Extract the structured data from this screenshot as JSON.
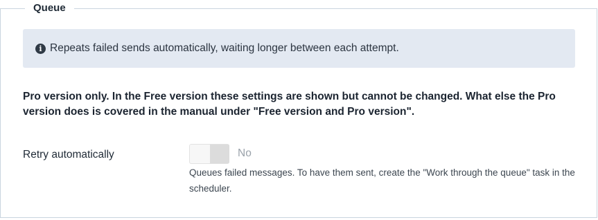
{
  "section": {
    "legend": "Queue"
  },
  "info": {
    "icon": "info-circle-icon",
    "text": "Repeats failed sends automatically, waiting longer between each attempt."
  },
  "pro_note": "Pro version only. In the Free version these settings are shown but cannot be changed. What else the Pro version does is covered in the manual under \"Free version and Pro version\".",
  "retry": {
    "label": "Retry automatically",
    "toggle_value": "No",
    "enabled": false,
    "description": "Queues failed messages. To have them sent, create the \"Work through the queue\" task in the scheduler."
  },
  "colors": {
    "alert_bg": "#e3e9f2",
    "border": "#c9d4df",
    "muted_text": "#9aa2aa"
  }
}
